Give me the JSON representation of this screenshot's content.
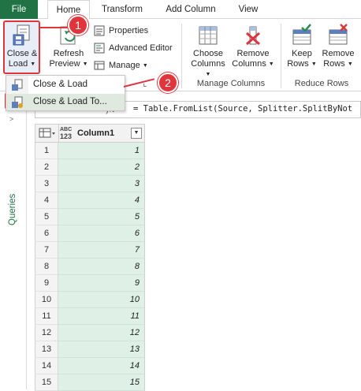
{
  "tabs": [
    "File",
    "Home",
    "Transform",
    "Add Column",
    "View"
  ],
  "ribbon": {
    "close_load": {
      "line1": "Close &",
      "line2": "Load"
    },
    "refresh": {
      "line1": "Refresh",
      "line2": "Preview"
    },
    "properties": "Properties",
    "advanced_editor": "Advanced Editor",
    "manage": "Manage",
    "choose_columns": {
      "line1": "Choose",
      "line2": "Columns"
    },
    "remove_columns": {
      "line1": "Remove",
      "line2": "Columns"
    },
    "keep_rows": {
      "line1": "Keep",
      "line2": "Rows"
    },
    "remove_rows": {
      "line1": "Remove",
      "line2": "Rows"
    },
    "group_manage_columns": "Manage Columns",
    "group_reduce_rows": "Reduce Rows"
  },
  "menu": {
    "items": [
      "Close & Load",
      "Close & Load To..."
    ]
  },
  "formula_bar": {
    "fx": "fx",
    "text": "= Table.FromList(Source, Splitter.SplitByNot"
  },
  "queries_pane": {
    "label": "Queries"
  },
  "grid": {
    "type_icon_top": "ABC",
    "type_icon_bottom": "123",
    "column_name": "Column1",
    "rows": [
      {
        "n": "1",
        "v": "1"
      },
      {
        "n": "2",
        "v": "2"
      },
      {
        "n": "3",
        "v": "3"
      },
      {
        "n": "4",
        "v": "4"
      },
      {
        "n": "5",
        "v": "5"
      },
      {
        "n": "6",
        "v": "6"
      },
      {
        "n": "7",
        "v": "7"
      },
      {
        "n": "8",
        "v": "8"
      },
      {
        "n": "9",
        "v": "9"
      },
      {
        "n": "10",
        "v": "10"
      },
      {
        "n": "11",
        "v": "11"
      },
      {
        "n": "12",
        "v": "12"
      },
      {
        "n": "13",
        "v": "13"
      },
      {
        "n": "14",
        "v": "14"
      },
      {
        "n": "15",
        "v": "15"
      }
    ]
  },
  "callouts": [
    "1",
    "2"
  ],
  "colors": {
    "accent_green": "#217346",
    "callout_red": "#e0353d",
    "cell_green": "#dff0e6"
  }
}
